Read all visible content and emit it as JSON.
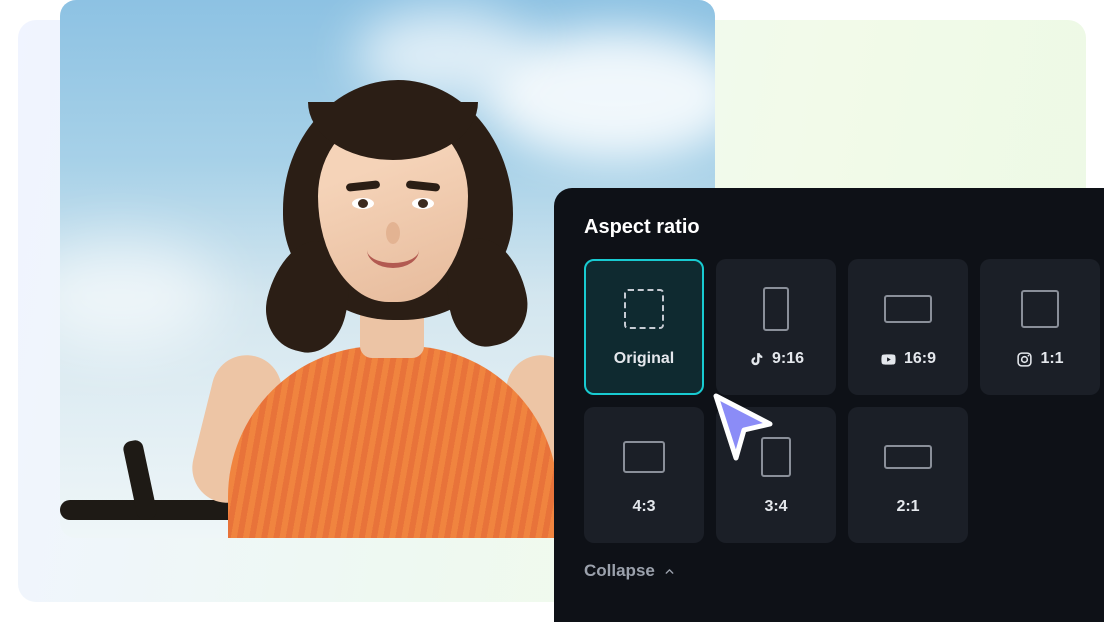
{
  "panel": {
    "title": "Aspect ratio",
    "collapse_label": "Collapse"
  },
  "ratios": [
    {
      "label": "Original",
      "shape_class": "shape-original",
      "platform_icon": null,
      "selected": true
    },
    {
      "label": "9:16",
      "shape_class": "shape-916",
      "platform_icon": "tiktok",
      "selected": false
    },
    {
      "label": "16:9",
      "shape_class": "shape-169",
      "platform_icon": "youtube",
      "selected": false
    },
    {
      "label": "1:1",
      "shape_class": "shape-11",
      "platform_icon": "instagram",
      "selected": false
    },
    {
      "label": "4:3",
      "shape_class": "shape-43",
      "platform_icon": null,
      "selected": false
    },
    {
      "label": "3:4",
      "shape_class": "shape-34",
      "platform_icon": null,
      "selected": false
    },
    {
      "label": "2:1",
      "shape_class": "shape-21",
      "platform_icon": null,
      "selected": false
    }
  ]
}
